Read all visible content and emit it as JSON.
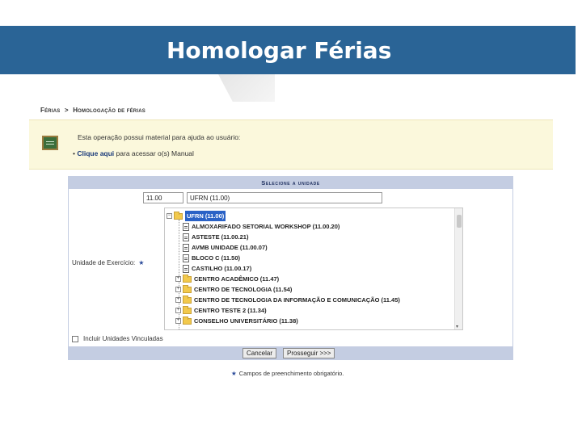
{
  "slide": {
    "title": "Homologar Férias"
  },
  "breadcrumb": {
    "parent": "Férias",
    "separator": ">",
    "current": "Homologação de férias"
  },
  "help": {
    "text": "Esta operação possui material para ajuda ao usuário:",
    "bullet": "•",
    "link_label": "Clique aqui",
    "link_suffix": " para acessar o(s) Manual"
  },
  "form": {
    "header": "Selecione a unidade",
    "code_value": "11.00",
    "name_value": "UFRN (11.00)",
    "field_label": "Unidade de Exercício:",
    "required_marker": "★",
    "tree": {
      "root": {
        "expander": "−",
        "label": "UFRN (11.00)"
      },
      "items": [
        {
          "kind": "doc",
          "label": "ALMOXARIFADO SETORIAL WORKSHOP (11.00.20)"
        },
        {
          "kind": "doc",
          "label": "ASTESTE (11.00.21)"
        },
        {
          "kind": "doc",
          "label": "AVMB UNIDADE (11.00.07)"
        },
        {
          "kind": "doc",
          "label": "BLOCO C (11.50)"
        },
        {
          "kind": "doc",
          "label": "CASTILHO (11.00.17)"
        },
        {
          "kind": "folder",
          "expander": "+",
          "label": "CENTRO ACADÊMICO (11.47)"
        },
        {
          "kind": "folder",
          "expander": "+",
          "label": "CENTRO DE TECNOLOGIA (11.54)"
        },
        {
          "kind": "folder",
          "expander": "+",
          "label": "CENTRO DE TECNOLOGIA DA INFORMAÇÃO E COMUNICAÇÃO (11.45)"
        },
        {
          "kind": "folder",
          "expander": "+",
          "label": "CENTRO TESTE 2 (11.34)"
        },
        {
          "kind": "folder",
          "expander": "+",
          "label": "CONSELHO UNIVERSITÁRIO (11.38)"
        }
      ],
      "scroll_down": "▾"
    },
    "checkbox_label": "Incluir Unidades Vinculadas",
    "buttons": {
      "cancel": "Cancelar",
      "next": "Prosseguir >>>"
    }
  },
  "footer": {
    "required_marker": "★",
    "required_note": "Campos de preenchimento obrigatório."
  },
  "colors": {
    "title_band": "#2a6496",
    "panel_header": "#c4cde2",
    "help_bg": "#fbf8dc",
    "selection": "#2a62c6"
  }
}
